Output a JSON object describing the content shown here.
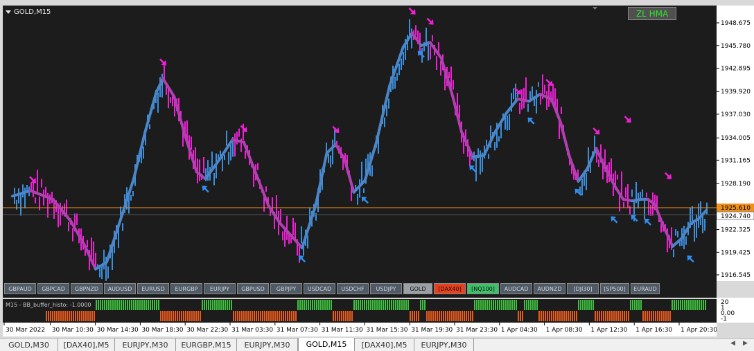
{
  "chart_title": "GOLD,M15",
  "indicator_box": "ZL HMA",
  "price_lines": {
    "bid": "1925.610",
    "ask": "1924.740"
  },
  "price_ticks": [
    "1948.675",
    "1945.780",
    "1942.895",
    "1939.920",
    "1937.030",
    "1934.005",
    "1931.165",
    "1928.190",
    "1925.610",
    "1922.325",
    "1919.425",
    "1916.545"
  ],
  "sub_label": "M15 - BB_buffer_histo: -1.0000",
  "sub_ticks": [
    "20",
    "1",
    "0.00",
    "-1"
  ],
  "time_ticks": [
    "30 Mar 2022",
    "30 Mar 10:30",
    "30 Mar 14:30",
    "30 Mar 18:30",
    "30 Mar 22:30",
    "31 Mar 03:30",
    "31 Mar 07:30",
    "31 Mar 11:30",
    "31 Mar 15:30",
    "31 Mar 19:30",
    "31 Mar 23:30",
    "1 Apr 04:30",
    "1 Apr 08:30",
    "1 Apr 12:30",
    "1 Apr 16:30",
    "1 Apr 20:30"
  ],
  "symbols": [
    {
      "label": "GBPAUD",
      "color": "#505a66"
    },
    {
      "label": "GBPCAD",
      "color": "#505a66"
    },
    {
      "label": "GBPNZD",
      "color": "#505a66"
    },
    {
      "label": "AUDUSD",
      "color": "#505a66"
    },
    {
      "label": "EURUSD",
      "color": "#505a66"
    },
    {
      "label": "EURGBP",
      "color": "#505a66"
    },
    {
      "label": "EURJPY",
      "color": "#505a66"
    },
    {
      "label": "GBPUSD",
      "color": "#505a66"
    },
    {
      "label": "GBPJPY",
      "color": "#505a66"
    },
    {
      "label": "USDCAD",
      "color": "#505a66"
    },
    {
      "label": "USDCHF",
      "color": "#505a66"
    },
    {
      "label": "USDJPY",
      "color": "#505a66"
    },
    {
      "label": "GOLD",
      "color": "#9aa0a6"
    },
    {
      "label": "[DAX40]",
      "color": "#e8401a"
    },
    {
      "label": "[NQ100]",
      "color": "#3fbf6a"
    },
    {
      "label": "AUDCAD",
      "color": "#505a66"
    },
    {
      "label": "AUDNZD",
      "color": "#505a66"
    },
    {
      "label": "[DJI30]",
      "color": "#505a66"
    },
    {
      "label": "[SP500]",
      "color": "#505a66"
    },
    {
      "label": "EURAUD",
      "color": "#505a66"
    }
  ],
  "tabs": [
    {
      "label": "GOLD,M30",
      "active": false
    },
    {
      "label": "[DAX40],M5",
      "active": false
    },
    {
      "label": "EURJPY,M30",
      "active": false
    },
    {
      "label": "EURGBP,M15",
      "active": false
    },
    {
      "label": "EURJPY,M30",
      "active": false
    },
    {
      "label": "GOLD,M15",
      "active": true
    },
    {
      "label": "[DAX40],M5",
      "active": false
    },
    {
      "label": "EURJPY,M30",
      "active": false
    }
  ],
  "colors": {
    "up": "#3a8fde",
    "down": "#f020d6",
    "hma_up": "#4a86c8",
    "hma_down": "#b040b0",
    "green": "#3fbf3f",
    "red": "#e65a1e",
    "bid_line": "#f09018"
  },
  "chart_data": {
    "type": "line",
    "x_labels": [
      "30 Mar 2022",
      "30 Mar 10:30",
      "30 Mar 14:30",
      "30 Mar 18:30",
      "30 Mar 22:30",
      "31 Mar 03:30",
      "31 Mar 07:30",
      "31 Mar 11:30",
      "31 Mar 15:30",
      "31 Mar 19:30",
      "31 Mar 23:30",
      "1 Apr 04:30",
      "1 Apr 08:30",
      "1 Apr 12:30",
      "1 Apr 16:30",
      "1 Apr 20:30"
    ],
    "ylim": [
      1916.0,
      1951.0
    ],
    "hma_points": [
      [
        0,
        1926.4
      ],
      [
        0.4,
        1927.1
      ],
      [
        0.9,
        1926.0
      ],
      [
        1.3,
        1923.2
      ],
      [
        1.6,
        1920.2
      ],
      [
        1.85,
        1917.1
      ],
      [
        2.1,
        1918.0
      ],
      [
        2.4,
        1923.3
      ],
      [
        2.7,
        1928.6
      ],
      [
        2.95,
        1934.5
      ],
      [
        3.2,
        1939.6
      ],
      [
        3.35,
        1941.4
      ],
      [
        3.6,
        1939.1
      ],
      [
        3.85,
        1934.0
      ],
      [
        4.1,
        1929.5
      ],
      [
        4.3,
        1928.6
      ],
      [
        4.6,
        1931.0
      ],
      [
        4.9,
        1933.6
      ],
      [
        5.15,
        1933.3
      ],
      [
        5.4,
        1929.6
      ],
      [
        5.7,
        1925.2
      ],
      [
        5.95,
        1923.0
      ],
      [
        6.2,
        1921.4
      ],
      [
        6.45,
        1919.8
      ],
      [
        6.75,
        1925.2
      ],
      [
        7.0,
        1931.9
      ],
      [
        7.2,
        1933.0
      ],
      [
        7.4,
        1931.0
      ],
      [
        7.6,
        1926.9
      ],
      [
        7.85,
        1928.4
      ],
      [
        8.1,
        1933.2
      ],
      [
        8.4,
        1940.5
      ],
      [
        8.7,
        1945.4
      ],
      [
        8.9,
        1947.2
      ],
      [
        9.1,
        1945.6
      ],
      [
        9.3,
        1946.0
      ],
      [
        9.55,
        1944.0
      ],
      [
        9.8,
        1939.2
      ],
      [
        10.0,
        1934.6
      ],
      [
        10.25,
        1931.4
      ],
      [
        10.5,
        1931.6
      ],
      [
        10.75,
        1934.6
      ],
      [
        11.0,
        1937.0
      ],
      [
        11.25,
        1938.8
      ],
      [
        11.5,
        1938.5
      ],
      [
        11.75,
        1939.4
      ],
      [
        12.0,
        1938.8
      ],
      [
        12.2,
        1935.9
      ],
      [
        12.4,
        1931.5
      ],
      [
        12.6,
        1928.3
      ],
      [
        12.8,
        1929.9
      ],
      [
        13.0,
        1932.5
      ],
      [
        13.2,
        1930.0
      ],
      [
        13.4,
        1927.8
      ],
      [
        13.6,
        1926.0
      ],
      [
        13.8,
        1925.8
      ],
      [
        14.0,
        1926.0
      ],
      [
        14.15,
        1926.0
      ],
      [
        14.3,
        1925.4
      ],
      [
        14.5,
        1922.5
      ],
      [
        14.7,
        1920.0
      ],
      [
        14.9,
        1921.0
      ],
      [
        15.1,
        1922.9
      ],
      [
        15.3,
        1923.6
      ],
      [
        15.45,
        1924.6
      ]
    ],
    "arrows_down": [
      [
        0.45,
        1928.5
      ],
      [
        3.35,
        1943.5
      ],
      [
        5.15,
        1935.0
      ],
      [
        7.2,
        1934.9
      ],
      [
        8.9,
        1950.0
      ],
      [
        9.3,
        1948.7
      ],
      [
        11.25,
        1939.8
      ],
      [
        11.95,
        1940.9
      ],
      [
        13.0,
        1934.7
      ],
      [
        13.7,
        1936.2
      ],
      [
        14.6,
        1929.0
      ]
    ],
    "arrows_up": [
      [
        4.3,
        1927.3
      ],
      [
        6.45,
        1918.4
      ],
      [
        7.85,
        1925.9
      ],
      [
        9.1,
        1944.5
      ],
      [
        10.25,
        1929.9
      ],
      [
        11.55,
        1936.0
      ],
      [
        12.6,
        1926.9
      ],
      [
        13.4,
        1923.4
      ],
      [
        13.85,
        1923.6
      ],
      [
        14.15,
        1923.1
      ],
      [
        15.1,
        1918.4
      ]
    ]
  }
}
